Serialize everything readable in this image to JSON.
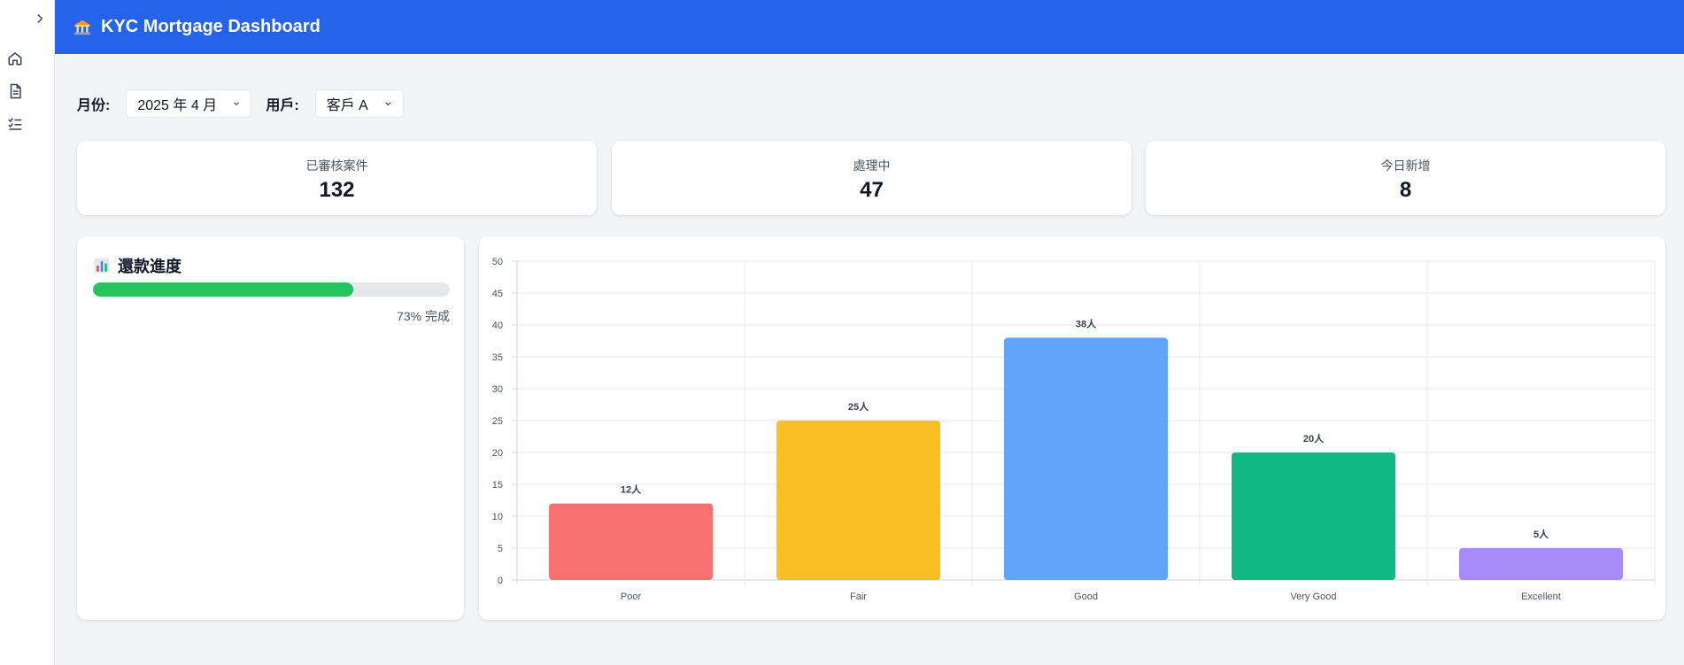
{
  "header": {
    "title": "KYC Mortgage Dashboard"
  },
  "filters": {
    "month_label": "月份:",
    "month_value": "2025 年 4 月",
    "user_label": "用戶:",
    "user_value": "客戶 A"
  },
  "stats": [
    {
      "label": "已審核案件",
      "value": "132"
    },
    {
      "label": "處理中",
      "value": "47"
    },
    {
      "label": "今日新增",
      "value": "8"
    }
  ],
  "progress": {
    "title": "還款進度",
    "value": 73,
    "text": "73% 完成",
    "color": "#22c55e"
  },
  "chart_data": {
    "type": "bar",
    "categories": [
      "Poor",
      "Fair",
      "Good",
      "Very Good",
      "Excellent"
    ],
    "values": [
      12,
      25,
      38,
      20,
      5
    ],
    "data_labels": [
      "12人",
      "25人",
      "38人",
      "20人",
      "5人"
    ],
    "colors": [
      "#f87171",
      "#fbbf24",
      "#60a5fa",
      "#10b981",
      "#a78bfa"
    ],
    "ylim": [
      0,
      50
    ],
    "yticks": [
      0,
      5,
      10,
      15,
      20,
      25,
      30,
      35,
      40,
      45,
      50
    ],
    "grid": true,
    "title": "",
    "xlabel": "",
    "ylabel": ""
  },
  "icons": {
    "expand": "chevron-right-icon",
    "home": "home-icon",
    "document": "document-icon",
    "tasks": "checklist-icon",
    "logo": "bank-icon",
    "chart": "bar-chart-icon",
    "dropdown": "chevron-down-icon"
  },
  "colors": {
    "header": "#2563eb",
    "background": "#f3f4f6"
  }
}
